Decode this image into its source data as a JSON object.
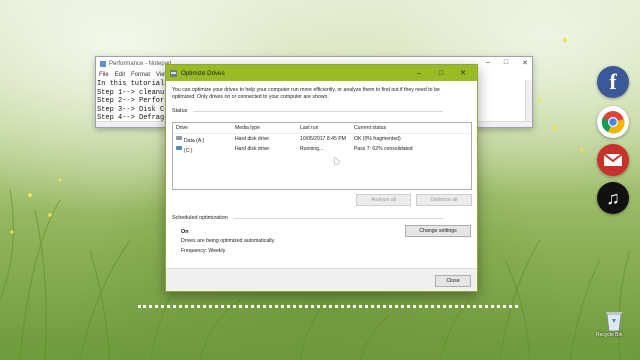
{
  "notepad": {
    "title": "Performance - Notepad",
    "menu": [
      "File",
      "Edit",
      "Format",
      "View"
    ],
    "lines": [
      "In this tutorial i",
      "Step 1-->   cleanu",
      "Step 2-->   Perfor",
      "Step 3-->   Disk C",
      "Step 4-->   Defrag"
    ]
  },
  "dialog": {
    "title": "Optimize Drives",
    "intro": "You can optimize your drives to help your computer run more efficiently, or analyze them to find out if they need to be optimized. Only drives on or connected to your computer are shown.",
    "status_label": "Status",
    "columns": [
      "Drive",
      "Media type",
      "Last run",
      "Current status"
    ],
    "drives": [
      {
        "drive": "Data (A:)",
        "media": "Hard disk drive",
        "last_run": "10/05/2017 8:45 PM",
        "status": "OK (0% fragmented)"
      },
      {
        "drive": "(C:)",
        "media": "Hard disk drive",
        "last_run": "Running...",
        "status": "Pass 7: 62% consolidated"
      }
    ],
    "analyze_all": "Analyze all",
    "optimize_all": "Optimize all",
    "scheduled_label": "Scheduled optimization",
    "schedule_state": "On",
    "schedule_desc": "Drives are being optimized automatically.",
    "frequency": "Frequency: Weekly",
    "change_settings": "Change settings",
    "close": "Close"
  },
  "desktop": {
    "icons": [
      "facebook-icon",
      "chrome-icon",
      "gmail-icon",
      "music-icon"
    ],
    "recycle_label": "Recycle Bin"
  },
  "colors": {
    "titlebar": "#9bbb26",
    "facebook": "#3b5998",
    "gmail": "#c7332b"
  }
}
